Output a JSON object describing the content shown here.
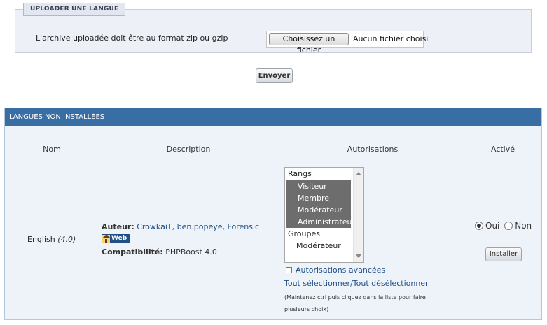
{
  "upload": {
    "legend": "UPLOADER UNE LANGUE",
    "label": "L'archive uploadée doit être au format zip ou gzip",
    "file_button": "Choisissez un fichier",
    "file_status": "Aucun fichier choisi",
    "submit": "Envoyer"
  },
  "table": {
    "title": "LANGUES NON INSTALLÉES",
    "columns": {
      "name": "Nom",
      "description": "Description",
      "permissions": "Autorisations",
      "active": "Activé"
    },
    "row": {
      "name": "English",
      "version": "(4.0)",
      "author_label": "Auteur:",
      "author_value": "CrowkaiT, ben.popeye, Forensic",
      "web_label": "Web",
      "compat_label": "Compatibilité:",
      "compat_value": "PHPBoost 4.0",
      "listbox": [
        {
          "label": "Rangs",
          "type": "group",
          "selected": false
        },
        {
          "label": "Visiteur",
          "type": "item",
          "selected": true
        },
        {
          "label": "Membre",
          "type": "item",
          "selected": true
        },
        {
          "label": "Modérateur",
          "type": "item",
          "selected": true
        },
        {
          "label": "Administrateur",
          "type": "item",
          "selected": true
        },
        {
          "label": "Groupes",
          "type": "group",
          "selected": false
        },
        {
          "label": "Modérateur",
          "type": "item",
          "selected": false
        }
      ],
      "advanced_link": "Autorisations avancées",
      "select_all": "Tout sélectionner/Tout désélectionner",
      "hint": "(Maintenez ctrl puis cliquez dans la liste pour faire plusieurs choix)",
      "radio_yes": "Oui",
      "radio_no": "Non",
      "active_selected": "Oui",
      "install_button": "Installer"
    }
  },
  "colors": {
    "header_bg": "#386ea3",
    "link": "#1f4f86",
    "panel_bg": "#eef3f9"
  }
}
